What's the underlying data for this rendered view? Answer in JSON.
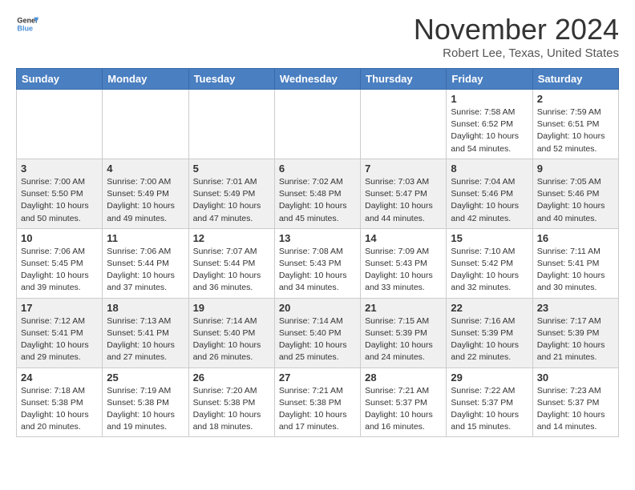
{
  "header": {
    "logo_general": "General",
    "logo_blue": "Blue",
    "month": "November 2024",
    "location": "Robert Lee, Texas, United States"
  },
  "weekdays": [
    "Sunday",
    "Monday",
    "Tuesday",
    "Wednesday",
    "Thursday",
    "Friday",
    "Saturday"
  ],
  "weeks": [
    [
      {
        "day": "",
        "info": ""
      },
      {
        "day": "",
        "info": ""
      },
      {
        "day": "",
        "info": ""
      },
      {
        "day": "",
        "info": ""
      },
      {
        "day": "",
        "info": ""
      },
      {
        "day": "1",
        "info": "Sunrise: 7:58 AM\nSunset: 6:52 PM\nDaylight: 10 hours\nand 54 minutes."
      },
      {
        "day": "2",
        "info": "Sunrise: 7:59 AM\nSunset: 6:51 PM\nDaylight: 10 hours\nand 52 minutes."
      }
    ],
    [
      {
        "day": "3",
        "info": "Sunrise: 7:00 AM\nSunset: 5:50 PM\nDaylight: 10 hours\nand 50 minutes."
      },
      {
        "day": "4",
        "info": "Sunrise: 7:00 AM\nSunset: 5:49 PM\nDaylight: 10 hours\nand 49 minutes."
      },
      {
        "day": "5",
        "info": "Sunrise: 7:01 AM\nSunset: 5:49 PM\nDaylight: 10 hours\nand 47 minutes."
      },
      {
        "day": "6",
        "info": "Sunrise: 7:02 AM\nSunset: 5:48 PM\nDaylight: 10 hours\nand 45 minutes."
      },
      {
        "day": "7",
        "info": "Sunrise: 7:03 AM\nSunset: 5:47 PM\nDaylight: 10 hours\nand 44 minutes."
      },
      {
        "day": "8",
        "info": "Sunrise: 7:04 AM\nSunset: 5:46 PM\nDaylight: 10 hours\nand 42 minutes."
      },
      {
        "day": "9",
        "info": "Sunrise: 7:05 AM\nSunset: 5:46 PM\nDaylight: 10 hours\nand 40 minutes."
      }
    ],
    [
      {
        "day": "10",
        "info": "Sunrise: 7:06 AM\nSunset: 5:45 PM\nDaylight: 10 hours\nand 39 minutes."
      },
      {
        "day": "11",
        "info": "Sunrise: 7:06 AM\nSunset: 5:44 PM\nDaylight: 10 hours\nand 37 minutes."
      },
      {
        "day": "12",
        "info": "Sunrise: 7:07 AM\nSunset: 5:44 PM\nDaylight: 10 hours\nand 36 minutes."
      },
      {
        "day": "13",
        "info": "Sunrise: 7:08 AM\nSunset: 5:43 PM\nDaylight: 10 hours\nand 34 minutes."
      },
      {
        "day": "14",
        "info": "Sunrise: 7:09 AM\nSunset: 5:43 PM\nDaylight: 10 hours\nand 33 minutes."
      },
      {
        "day": "15",
        "info": "Sunrise: 7:10 AM\nSunset: 5:42 PM\nDaylight: 10 hours\nand 32 minutes."
      },
      {
        "day": "16",
        "info": "Sunrise: 7:11 AM\nSunset: 5:41 PM\nDaylight: 10 hours\nand 30 minutes."
      }
    ],
    [
      {
        "day": "17",
        "info": "Sunrise: 7:12 AM\nSunset: 5:41 PM\nDaylight: 10 hours\nand 29 minutes."
      },
      {
        "day": "18",
        "info": "Sunrise: 7:13 AM\nSunset: 5:41 PM\nDaylight: 10 hours\nand 27 minutes."
      },
      {
        "day": "19",
        "info": "Sunrise: 7:14 AM\nSunset: 5:40 PM\nDaylight: 10 hours\nand 26 minutes."
      },
      {
        "day": "20",
        "info": "Sunrise: 7:14 AM\nSunset: 5:40 PM\nDaylight: 10 hours\nand 25 minutes."
      },
      {
        "day": "21",
        "info": "Sunrise: 7:15 AM\nSunset: 5:39 PM\nDaylight: 10 hours\nand 24 minutes."
      },
      {
        "day": "22",
        "info": "Sunrise: 7:16 AM\nSunset: 5:39 PM\nDaylight: 10 hours\nand 22 minutes."
      },
      {
        "day": "23",
        "info": "Sunrise: 7:17 AM\nSunset: 5:39 PM\nDaylight: 10 hours\nand 21 minutes."
      }
    ],
    [
      {
        "day": "24",
        "info": "Sunrise: 7:18 AM\nSunset: 5:38 PM\nDaylight: 10 hours\nand 20 minutes."
      },
      {
        "day": "25",
        "info": "Sunrise: 7:19 AM\nSunset: 5:38 PM\nDaylight: 10 hours\nand 19 minutes."
      },
      {
        "day": "26",
        "info": "Sunrise: 7:20 AM\nSunset: 5:38 PM\nDaylight: 10 hours\nand 18 minutes."
      },
      {
        "day": "27",
        "info": "Sunrise: 7:21 AM\nSunset: 5:38 PM\nDaylight: 10 hours\nand 17 minutes."
      },
      {
        "day": "28",
        "info": "Sunrise: 7:21 AM\nSunset: 5:37 PM\nDaylight: 10 hours\nand 16 minutes."
      },
      {
        "day": "29",
        "info": "Sunrise: 7:22 AM\nSunset: 5:37 PM\nDaylight: 10 hours\nand 15 minutes."
      },
      {
        "day": "30",
        "info": "Sunrise: 7:23 AM\nSunset: 5:37 PM\nDaylight: 10 hours\nand 14 minutes."
      }
    ]
  ]
}
